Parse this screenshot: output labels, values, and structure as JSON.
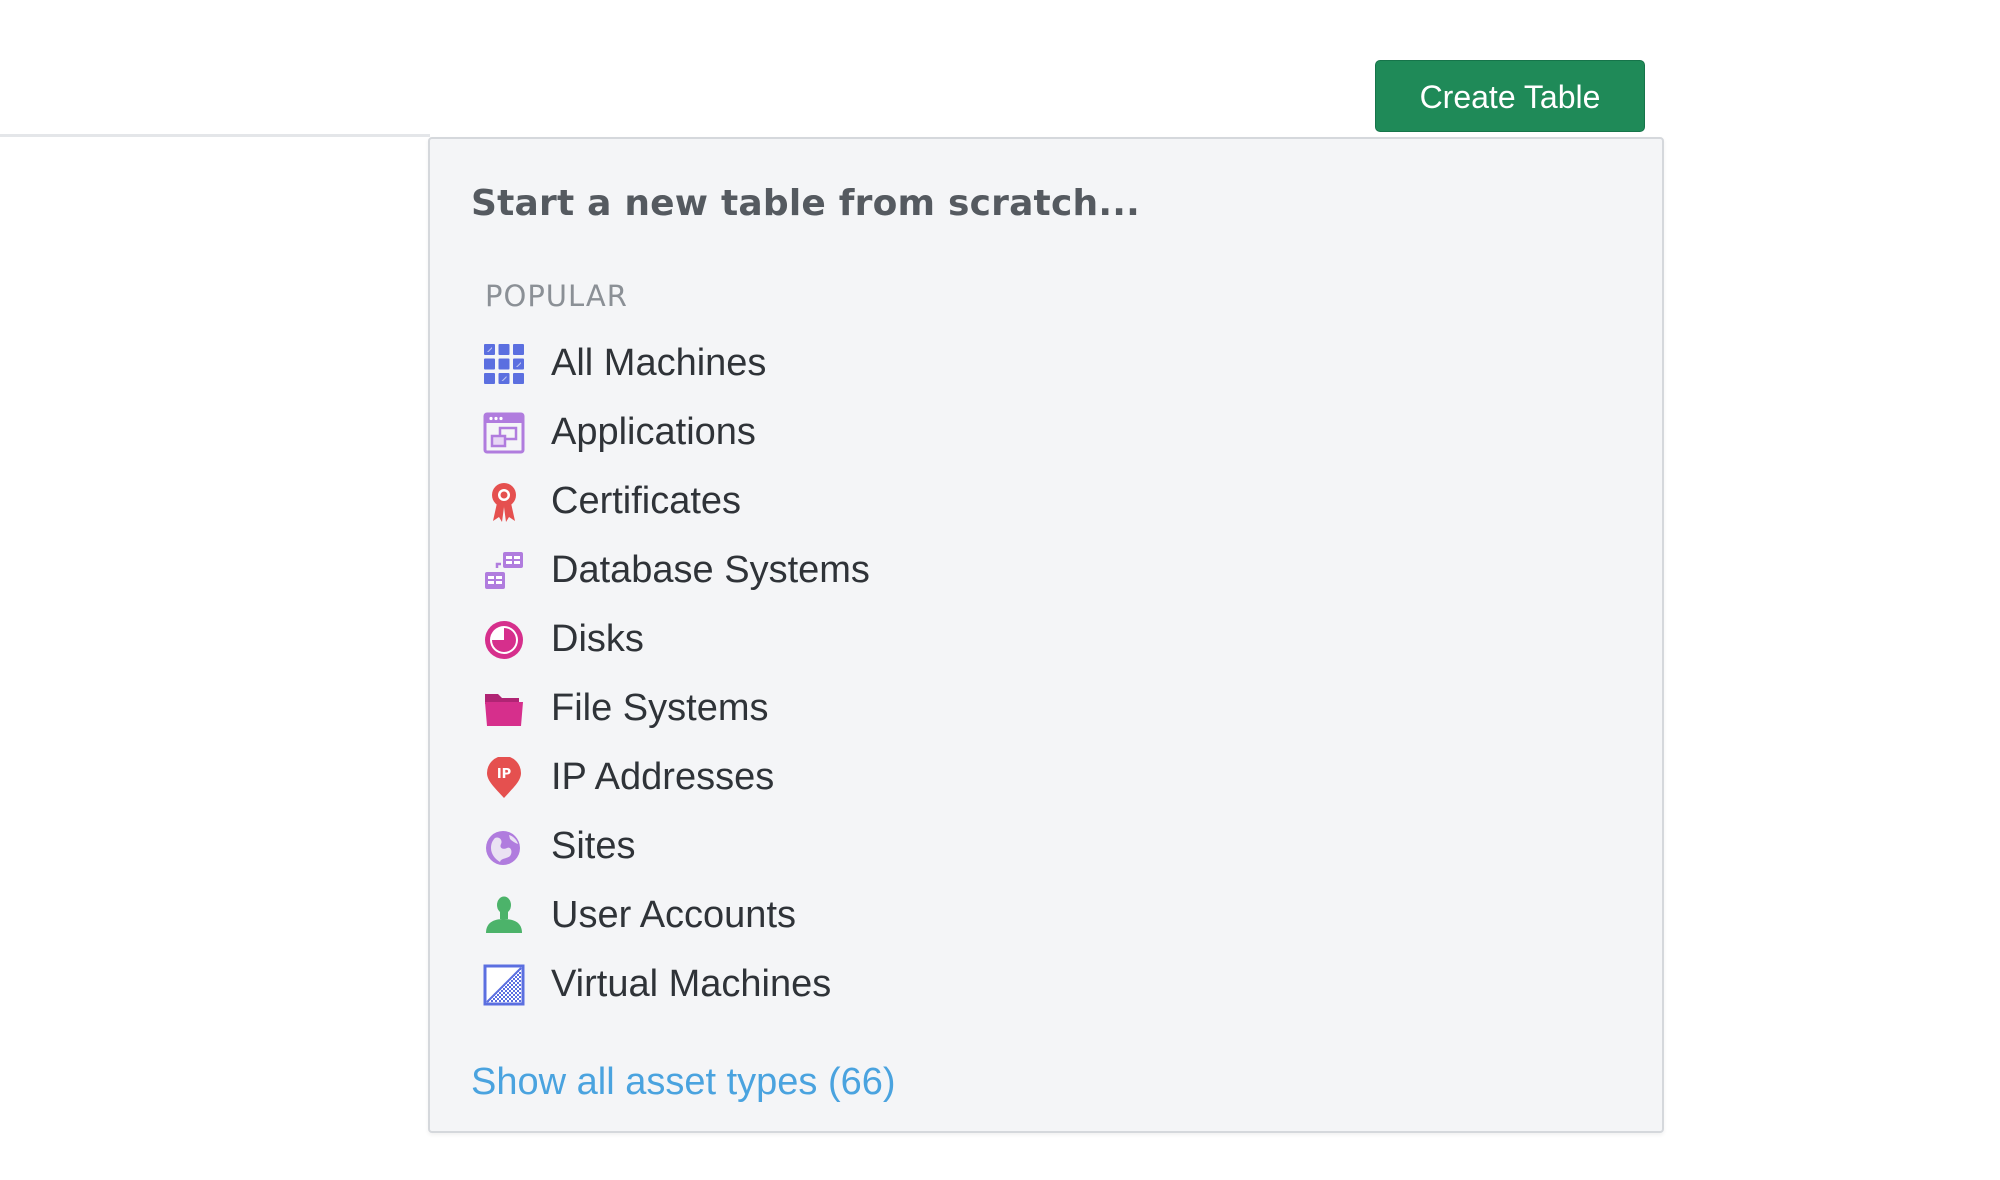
{
  "toolbar": {
    "create_table_label": "Create Table"
  },
  "dropdown": {
    "title": "Start a new table from scratch...",
    "section_label": "POPULAR",
    "items": [
      {
        "label": "All Machines",
        "icon": "grid-icon",
        "color": "#5b6fe0"
      },
      {
        "label": "Applications",
        "icon": "application-window-icon",
        "color": "#b07cde"
      },
      {
        "label": "Certificates",
        "icon": "certificate-ribbon-icon",
        "color": "#e5504f"
      },
      {
        "label": "Database Systems",
        "icon": "database-tables-icon",
        "color": "#b07cde"
      },
      {
        "label": "Disks",
        "icon": "disk-pie-icon",
        "color": "#d62f8c"
      },
      {
        "label": "File Systems",
        "icon": "folder-icon",
        "color": "#d62f8c"
      },
      {
        "label": "IP Addresses",
        "icon": "ip-pin-icon",
        "color": "#e5504f"
      },
      {
        "label": "Sites",
        "icon": "globe-icon",
        "color": "#b07cde"
      },
      {
        "label": "User Accounts",
        "icon": "user-icon",
        "color": "#4cb36a"
      },
      {
        "label": "Virtual Machines",
        "icon": "virtual-machine-icon",
        "color": "#5b6fe0"
      }
    ],
    "show_all_label": "Show all asset types (66)"
  },
  "colors": {
    "create_button": "#1f8a58",
    "link": "#4aa3df"
  }
}
